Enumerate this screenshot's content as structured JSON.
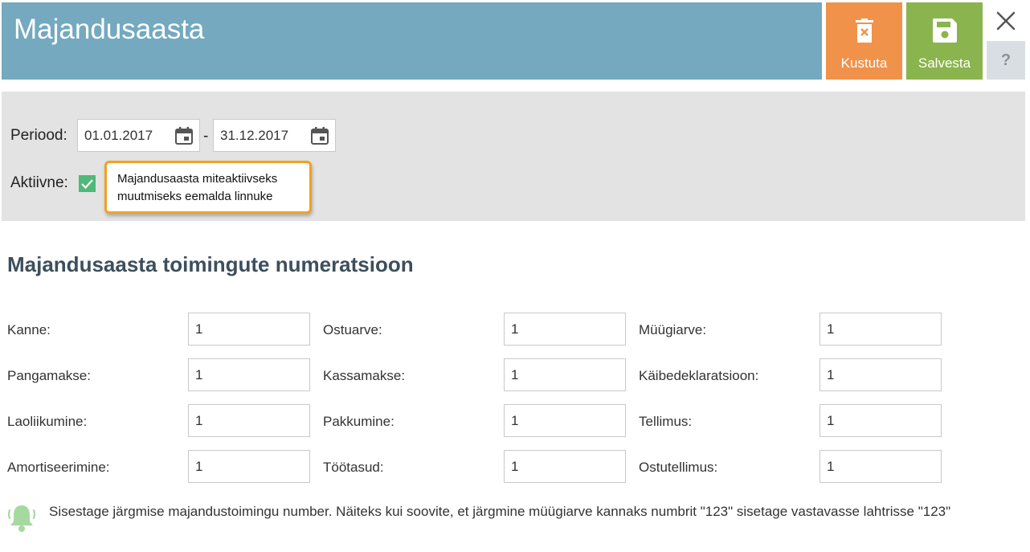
{
  "header": {
    "title": "Majandusaasta",
    "delete_label": "Kustuta",
    "save_label": "Salvesta",
    "help_label": "?"
  },
  "filter": {
    "period_label": "Periood:",
    "date_from": "01.01.2017",
    "date_separator": "-",
    "date_to": "31.12.2017",
    "active_label": "Aktiivne:",
    "active_checked": true,
    "tooltip_line1": "Majandusaasta miteaktiivseks",
    "tooltip_line2": "muutmiseks eemalda linnuke"
  },
  "section": {
    "title": "Majandusaasta toimingute numeratsioon",
    "fields": [
      {
        "label": "Kanne:",
        "value": "1"
      },
      {
        "label": "Ostuarve:",
        "value": "1"
      },
      {
        "label": "Müügiarve:",
        "value": "1"
      },
      {
        "label": "Pangamakse:",
        "value": "1"
      },
      {
        "label": "Kassamakse:",
        "value": "1"
      },
      {
        "label": "Käibedeklaratsioon:",
        "value": "1"
      },
      {
        "label": "Laoliikumine:",
        "value": "1"
      },
      {
        "label": "Pakkumine:",
        "value": "1"
      },
      {
        "label": "Tellimus:",
        "value": "1"
      },
      {
        "label": "Amortiseerimine:",
        "value": "1"
      },
      {
        "label": "Töötasud:",
        "value": "1"
      },
      {
        "label": "Ostutellimus:",
        "value": "1"
      }
    ],
    "hint": "Sisestage järgmise majandustoimingu number. Näiteks kui soovite, et järgmine müügiarve kannaks numbrit \"123\" sisetage vastavasse lahtrisse \"123\""
  },
  "colors": {
    "header_bg": "#74a9bf",
    "delete_bg": "#f0924a",
    "save_bg": "#8ab44d",
    "checkbox": "#4fb978",
    "tooltip_border": "#f2a21f",
    "bell": "#a6d9a0"
  },
  "icons": {
    "delete": "trash-icon",
    "save": "floppy-disk-icon",
    "close": "close-icon",
    "calendar": "calendar-icon",
    "check": "checkmark-icon",
    "hint": "bell-icon"
  }
}
